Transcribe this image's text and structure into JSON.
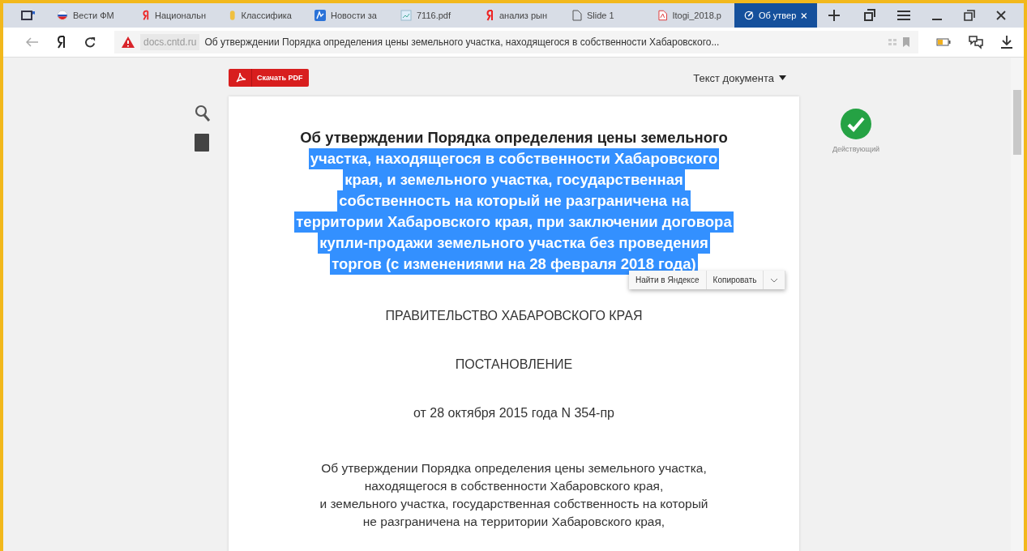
{
  "tabs": [
    {
      "kind": "flag",
      "label": "Вести ФМ",
      "selected": false
    },
    {
      "kind": "yandex",
      "label": "Национальн",
      "selected": false
    },
    {
      "kind": "coin",
      "label": "Классифика",
      "selected": false
    },
    {
      "kind": "news",
      "label": "Новости за",
      "selected": false
    },
    {
      "kind": "image",
      "label": "7116.pdf",
      "selected": false
    },
    {
      "kind": "yandex",
      "label": "анализ рын",
      "selected": false
    },
    {
      "kind": "file",
      "label": "Slide 1",
      "selected": false
    },
    {
      "kind": "pdf",
      "label": "Itogi_2018.p",
      "selected": false
    },
    {
      "kind": "edit",
      "label": "Об утвер",
      "selected": true
    }
  ],
  "address_bar": {
    "domain": "docs.cntd.ru",
    "title": "Об утверждении Порядка определения цены земельного участка, находящегося в собственности Хабаровского..."
  },
  "toolbar": {
    "download_button": "Скачать PDF",
    "view_menu": "Текст документа"
  },
  "status": {
    "label": "Действующий"
  },
  "document": {
    "title_lines": [
      {
        "text": "Об утверждении Порядка определения цены земельного",
        "selected": false
      },
      {
        "text": "участка, находящегося в собственности Хабаровского",
        "selected": true
      },
      {
        "text": "края, и земельного участка, государственная",
        "selected": true
      },
      {
        "text": "собственность на который не разграничена на",
        "selected": true
      },
      {
        "text": "территории Хабаровского края, при заключении договора",
        "selected": true
      },
      {
        "text": "купли-продажи земельного участка без проведения",
        "selected": true
      },
      {
        "text": "торгов (с изменениями на 28 февраля 2018 года)",
        "selected": true
      }
    ],
    "selection_menu": [
      "Найти в Яндексе",
      "Копировать"
    ],
    "authority": "ПРАВИТЕЛЬСТВО ХАБАРОВСКОГО КРАЯ",
    "doc_type": "ПОСТАНОВЛЕНИЕ",
    "date_line": "от 28 октября 2015 года N 354-пр",
    "intro_lines": [
      "Об утверждении Порядка определения цены земельного участка,",
      "находящегося в собственности Хабаровского края,",
      "и земельного участка, государственная собственность на который",
      "не разграничена на территории Хабаровского края,"
    ]
  }
}
